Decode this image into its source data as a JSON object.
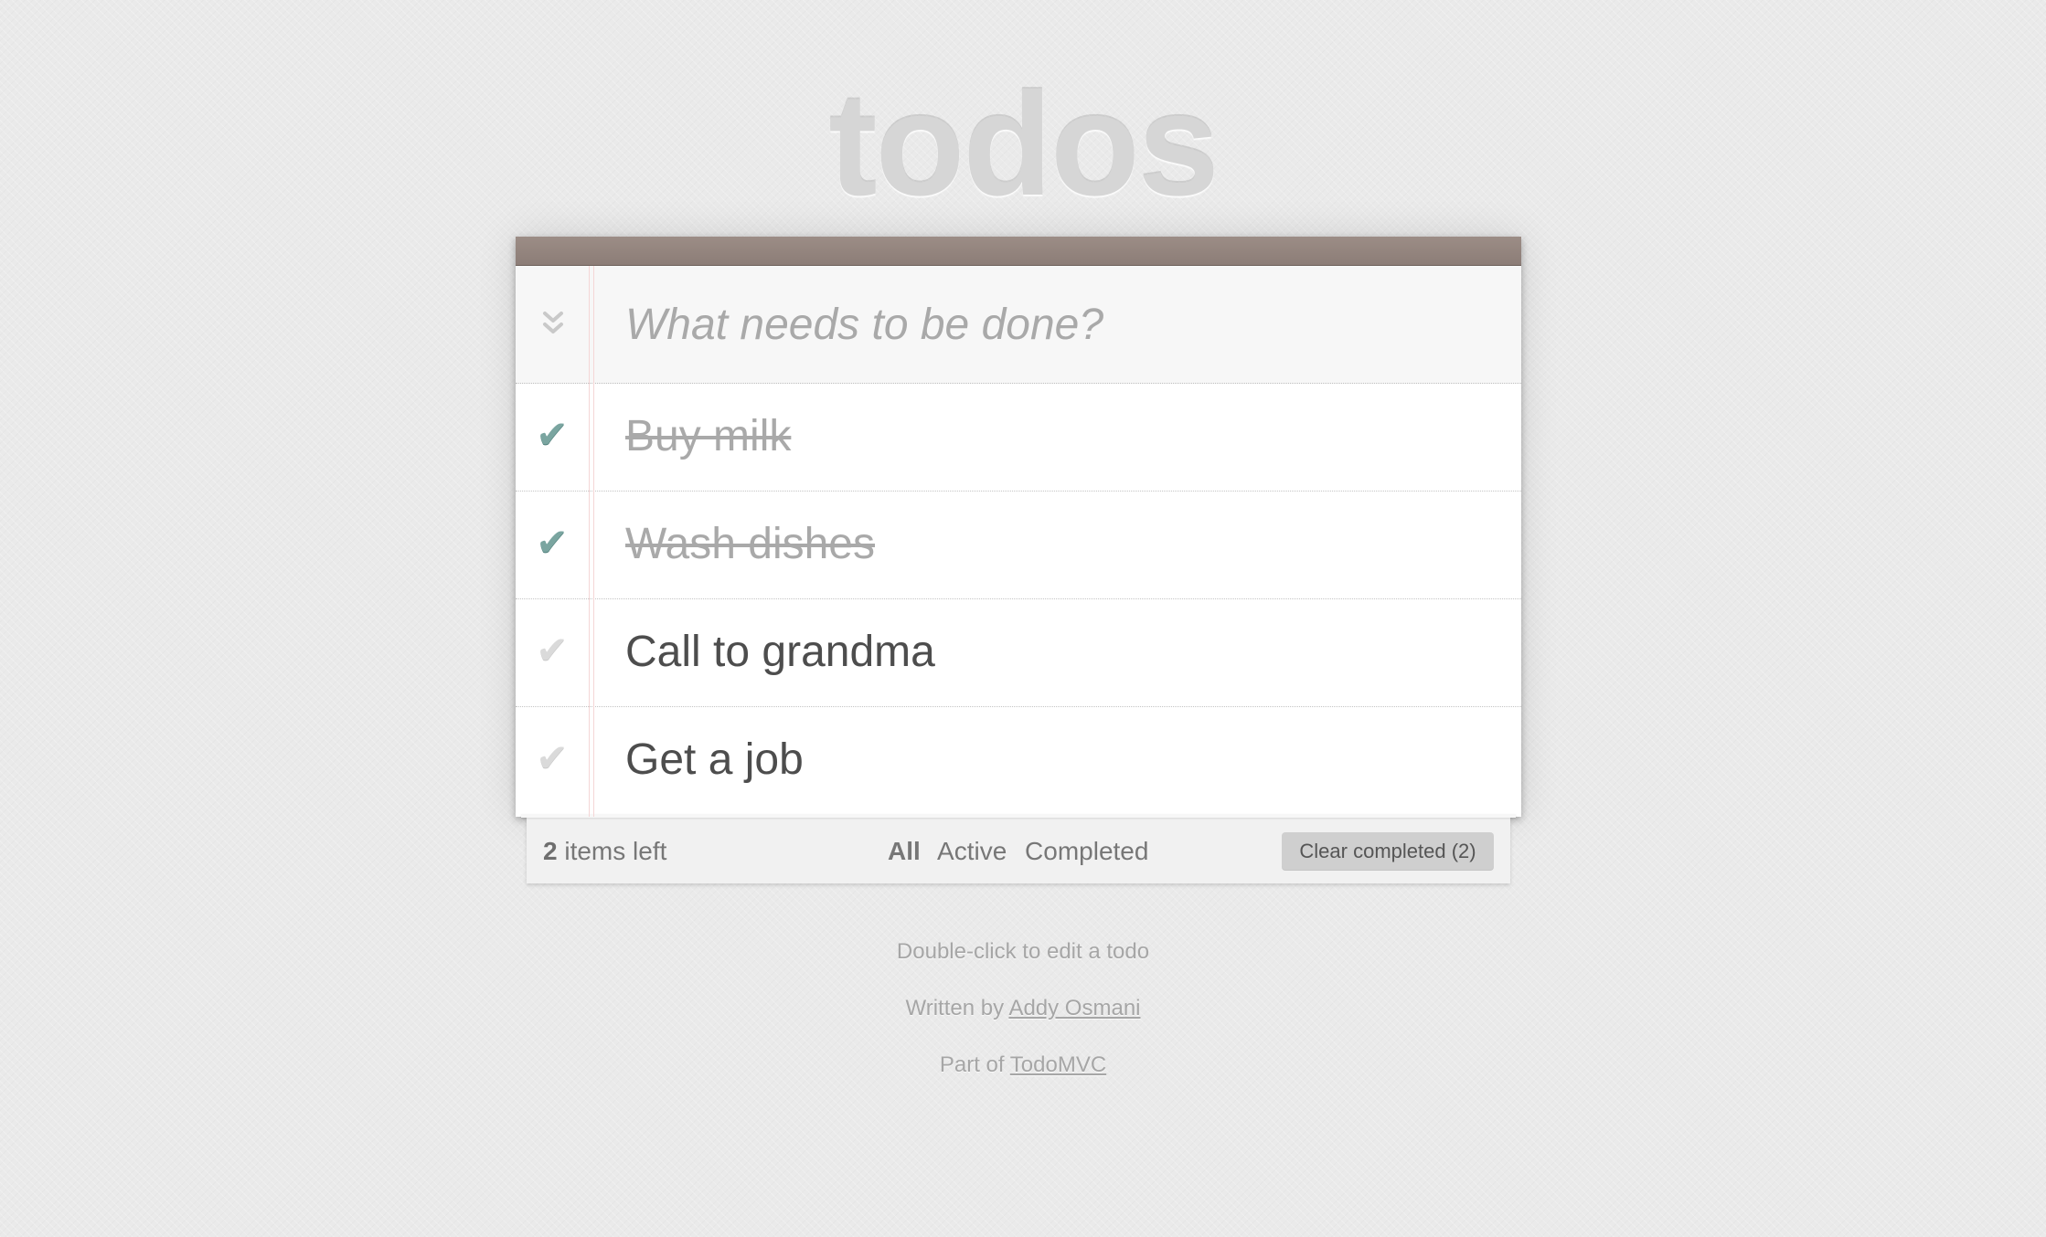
{
  "app": {
    "title": "todos"
  },
  "new_todo": {
    "placeholder": "What needs to be done?",
    "value": ""
  },
  "todos": [
    {
      "label": "Buy milk",
      "completed": true
    },
    {
      "label": "Wash dishes",
      "completed": true
    },
    {
      "label": "Call to grandma",
      "completed": false
    },
    {
      "label": "Get a job",
      "completed": false
    }
  ],
  "footer": {
    "count": "2",
    "count_suffix": " items left",
    "filters": [
      {
        "label": "All",
        "selected": true
      },
      {
        "label": "Active",
        "selected": false
      },
      {
        "label": "Completed",
        "selected": false
      }
    ],
    "clear_label": "Clear completed (2)"
  },
  "info": {
    "hint": "Double-click to edit a todo",
    "written_prefix": "Written by ",
    "author": "Addy Osmani",
    "part_prefix": "Part of ",
    "project": "TodoMVC"
  },
  "colors": {
    "header_bar": "#9c8d86",
    "check_done": "#7aa5a0",
    "check_undone": "#dadada",
    "margin_line": "#f5d6d6"
  },
  "icons": {
    "toggle_all": "double-chevron-down-icon",
    "check": "checkmark-icon"
  }
}
